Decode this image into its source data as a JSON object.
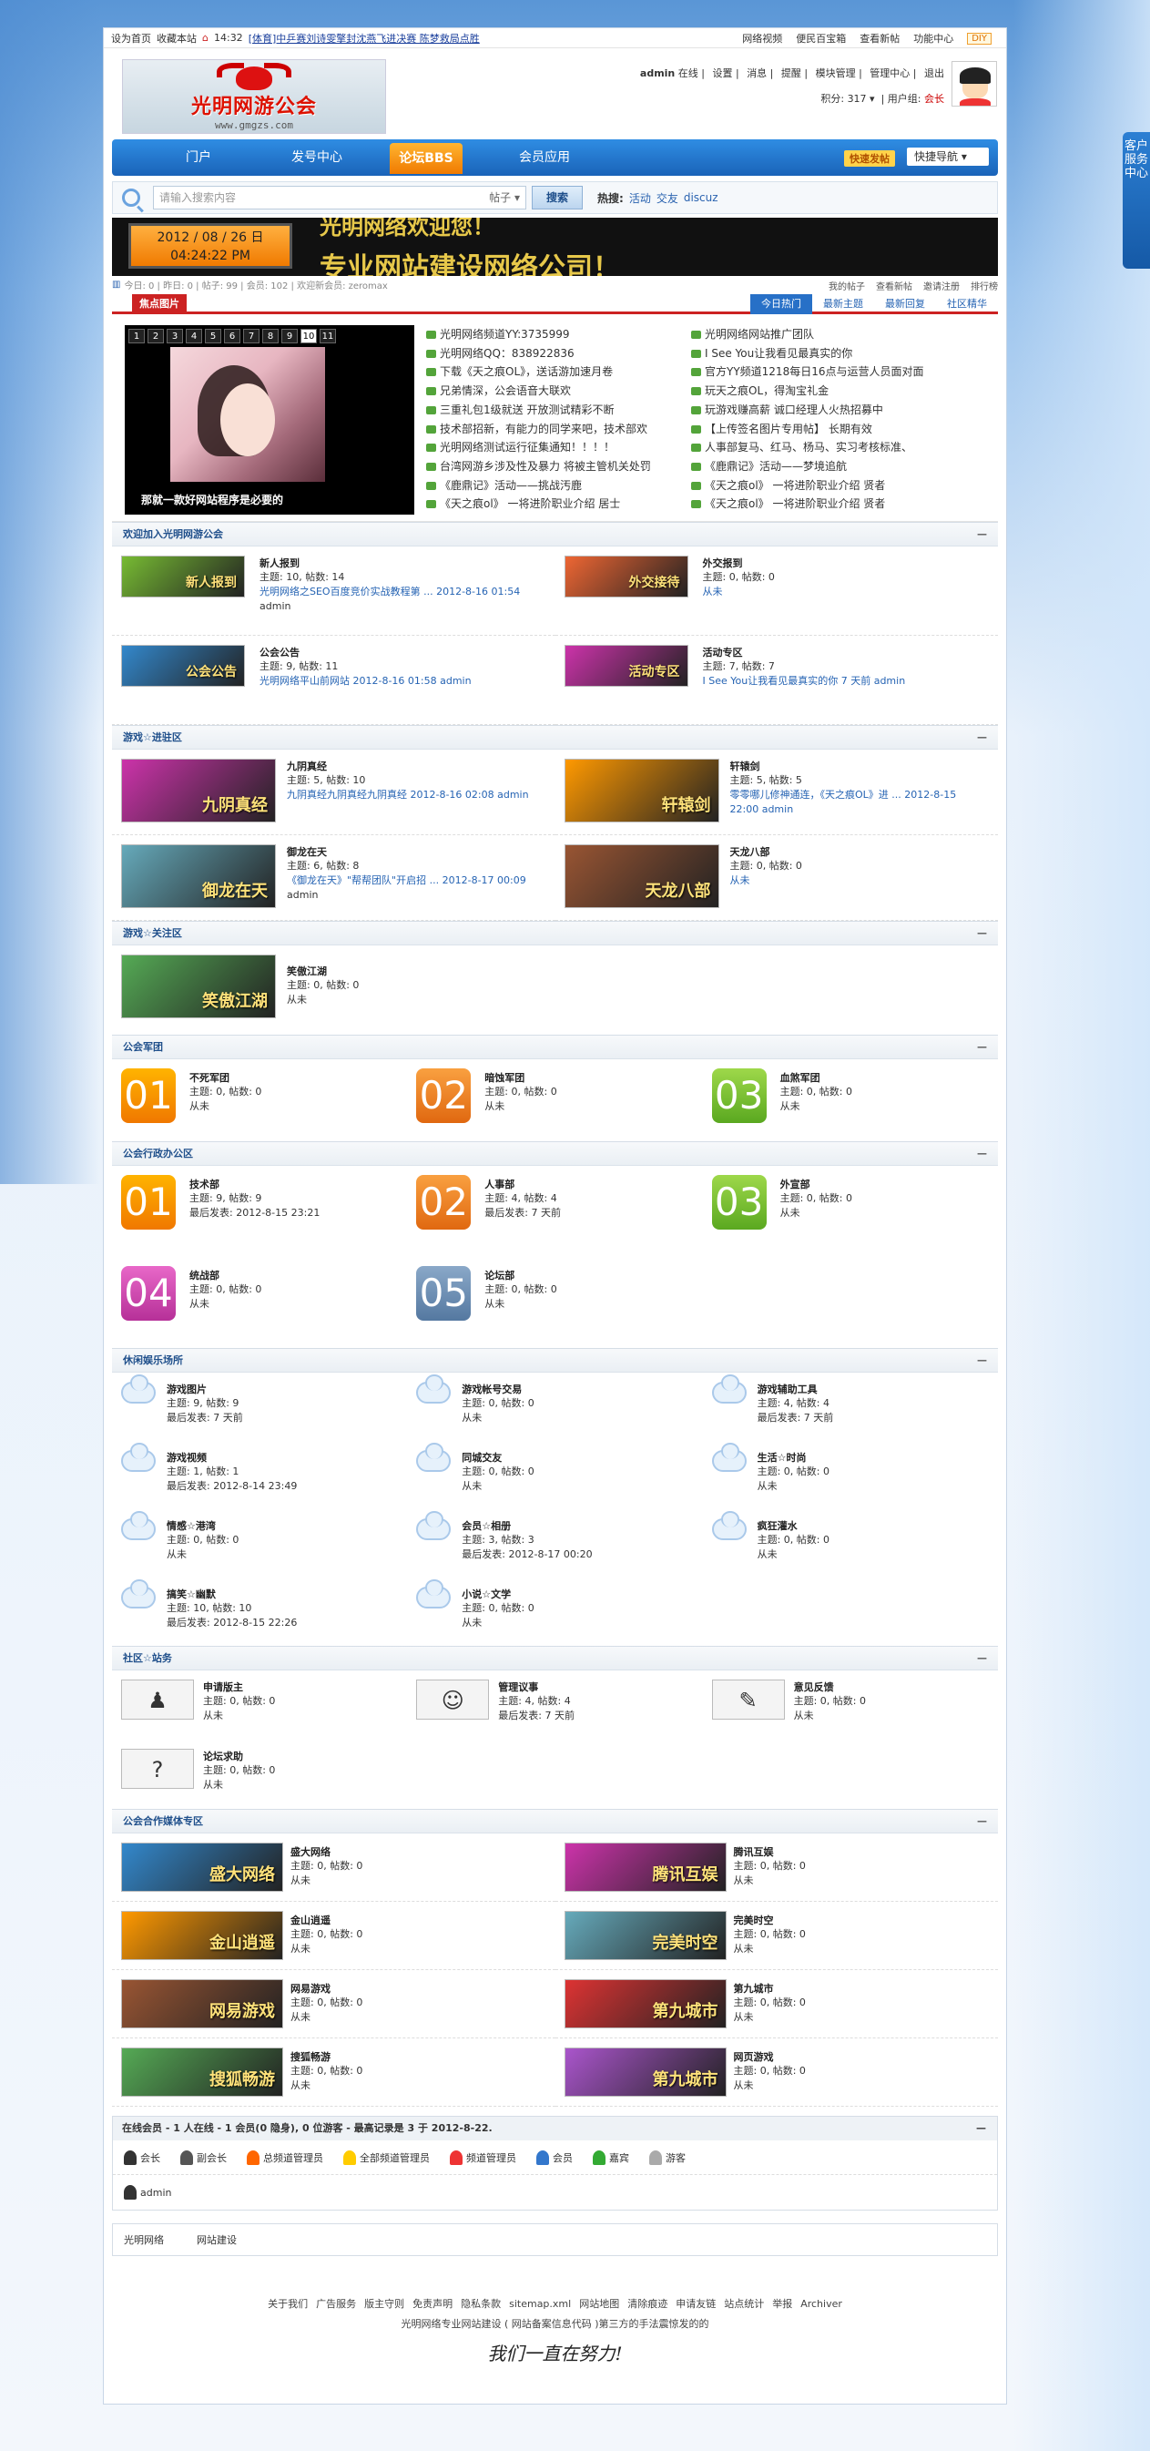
{
  "topbar": {
    "set_home": "设为首页",
    "bookmark": "收藏本站",
    "time": "14:32",
    "news": "[体育]中乒赛刘诗雯擎封沈燕飞进决赛 陈梦救局点胜",
    "right": [
      "网络视频",
      "便民百宝箱",
      "查看新帖",
      "功能中心"
    ],
    "diy": "DIY"
  },
  "logo": {
    "name": "光明网游公会",
    "url": "www.gmgzs.com"
  },
  "user": {
    "name": "admin",
    "status": "在线",
    "links": [
      "设置",
      "消息",
      "提醒",
      "模块管理",
      "管理中心",
      "退出"
    ],
    "points_label": "积分:",
    "points": "317",
    "group_label": "用户组:",
    "group": "会长"
  },
  "nav": {
    "items": [
      "门户",
      "发号中心",
      "论坛BBS",
      "会员应用"
    ],
    "post": "快速发帖",
    "quick": "快捷导航"
  },
  "search": {
    "placeholder": "请输入搜索内容",
    "type": "帖子",
    "button": "搜索",
    "hot_label": "热搜:",
    "hot": [
      "活动",
      "交友",
      "discuz"
    ]
  },
  "banner": {
    "date": "2012 / 08 / 26  日",
    "time": "04:24:22  PM",
    "line1": "光明网络欢迎您！",
    "line2": "专业网站建设网络公司！"
  },
  "stats": {
    "text": "今日: 0 | 昨日: 0 | 帖子: 99 | 会员: 102 | 欢迎新会员: zeromax",
    "links": [
      "我的帖子",
      "查看新帖",
      "邀请注册",
      "排行榜"
    ]
  },
  "tabs": {
    "left": "焦点图片",
    "right": [
      "今日热门",
      "最新主题",
      "最新回复",
      "社区精华"
    ]
  },
  "slider": {
    "nums": [
      "1",
      "2",
      "3",
      "4",
      "5",
      "6",
      "7",
      "8",
      "9",
      "10",
      "11"
    ],
    "current": "10",
    "caption": "那就一款好网站程序是必要的"
  },
  "focus": {
    "col1": [
      "光明网络频道YY:3735999",
      "光明网络QQ：838922836",
      "下载《天之痕OL》，送话游加速月卷",
      "兄弟情深，公会语音大联欢",
      "三重礼包1级就送 开放测试精彩不断",
      "技术部招新，有能力的同学来吧，技术部欢",
      "光明网络测试运行征集通知！！！！",
      "台湾网游乡涉及性及暴力 将被主管机关处罚",
      "《鹿鼎记》活动——挑战汚鹿",
      "《天之痕ol》 一将进阶职业介绍 居士"
    ],
    "col2": [
      "光明网络网站推广团队",
      "I See You让我看见最真实的你",
      "官方YY频道1218每日16点与运营人员面对面",
      "玩天之痕OL，得淘宝礼金",
      "玩游戏赚高薪 诚口经理人火热招募中",
      "【上传签名图片专用帖】 长期有效",
      "人事部复马、红马、杨马、实习考核标准、",
      "《鹿鼎记》活动——梦境追航",
      "《天之痕ol》 一将进阶职业介绍 贤者",
      "《天之痕ol》 一将进阶职业介绍 贤者"
    ]
  },
  "sec1": {
    "title": "欢迎加入光明网游公会",
    "forums": [
      {
        "name": "新人报到",
        "stat": "主题: 10, 帖数: 14",
        "last": "光明网络之SEO百度竞价实战教程第 ... 2012-8-16 01:54",
        "who": "admin",
        "img": "新人报到"
      },
      {
        "name": "外交报到",
        "stat": "主题: 0, 帖数: 0",
        "last": "从未",
        "who": "",
        "img": "外交接待"
      },
      {
        "name": "公会公告",
        "stat": "主题: 9, 帖数: 11",
        "last": "光明网络平山前网站 2012-8-16 01:58 admin",
        "who": "",
        "img": "公会公告"
      },
      {
        "name": "活动专区",
        "stat": "主题: 7, 帖数: 7",
        "last": "I See You让我看见最真实的你 7 天前 admin",
        "who": "",
        "img": "活动专区"
      }
    ]
  },
  "sec2": {
    "title": "游戏☆进驻区",
    "forums": [
      {
        "name": "九阴真经",
        "stat": "主题: 5, 帖数: 10",
        "last": "九阴真经九阴真经九阴真经 2012-8-16 02:08 admin",
        "img": "九阴真经"
      },
      {
        "name": "轩辕剑",
        "stat": "主题: 5, 帖数: 5",
        "last": "零零哪儿修神通连，《天之痕OL》进 ... 2012-8-15 22:00 admin",
        "img": "轩辕剑"
      },
      {
        "name": "御龙在天",
        "stat": "主题: 6, 帖数: 8",
        "last": "《御龙在天》\"帮帮团队\"开启招 ... 2012-8-17 00:09",
        "who": "admin",
        "img": "御龙在天"
      },
      {
        "name": "天龙八部",
        "stat": "主题: 0, 帖数: 0",
        "last": "从未",
        "img": "天龙八部"
      }
    ]
  },
  "sec3": {
    "title": "游戏☆关注区",
    "forums": [
      {
        "name": "笑傲江湖",
        "stat": "主题: 0, 帖数: 0",
        "last": "从未",
        "img": "笑傲江湖"
      }
    ]
  },
  "sec4": {
    "title": "公会军团",
    "forums": [
      {
        "num": "01",
        "name": "不死军团",
        "stat": "主题: 0, 帖数: 0",
        "last": "从未"
      },
      {
        "num": "02",
        "name": "暗蚀军团",
        "stat": "主题: 0, 帖数: 0",
        "last": "从未"
      },
      {
        "num": "03",
        "name": "血煞军团",
        "stat": "主题: 0, 帖数: 0",
        "last": "从未"
      }
    ]
  },
  "sec5": {
    "title": "公会行政办公区",
    "forums": [
      {
        "num": "01",
        "name": "技术部",
        "stat": "主题: 9, 帖数: 9",
        "last": "最后发表: 2012-8-15 23:21"
      },
      {
        "num": "02",
        "name": "人事部",
        "stat": "主题: 4, 帖数: 4",
        "last": "最后发表: 7 天前"
      },
      {
        "num": "03",
        "name": "外宣部",
        "stat": "主题: 0, 帖数: 0",
        "last": "从未"
      },
      {
        "num": "04",
        "name": "统战部",
        "stat": "主题: 0, 帖数: 0",
        "last": "从未"
      },
      {
        "num": "05",
        "name": "论坛部",
        "stat": "主题: 0, 帖数: 0",
        "last": "从未"
      }
    ]
  },
  "sec6": {
    "title": "休闲娱乐场所",
    "forums": [
      {
        "name": "游戏图片",
        "stat": "主题: 9, 帖数: 9",
        "last": "最后发表: 7 天前"
      },
      {
        "name": "游戏帐号交易",
        "stat": "主题: 0, 帖数: 0",
        "last": "从未"
      },
      {
        "name": "游戏辅助工具",
        "stat": "主题: 4, 帖数: 4",
        "last": "最后发表: 7 天前"
      },
      {
        "name": "游戏视频",
        "stat": "主题: 1, 帖数: 1",
        "last": "最后发表: 2012-8-14 23:49"
      },
      {
        "name": "同城交友",
        "stat": "主题: 0, 帖数: 0",
        "last": "从未"
      },
      {
        "name": "生活☆时尚",
        "stat": "主题: 0, 帖数: 0",
        "last": "从未"
      },
      {
        "name": "情感☆港湾",
        "stat": "主题: 0, 帖数: 0",
        "last": "从未"
      },
      {
        "name": "会员☆相册",
        "stat": "主题: 3, 帖数: 3",
        "last": "最后发表: 2012-8-17 00:20"
      },
      {
        "name": "疯狂灌水",
        "stat": "主题: 0, 帖数: 0",
        "last": "从未"
      },
      {
        "name": "搞笑☆幽默",
        "stat": "主题: 10, 帖数: 10",
        "last": "最后发表: 2012-8-15 22:26"
      },
      {
        "name": "小说☆文学",
        "stat": "主题: 0, 帖数: 0",
        "last": "从未"
      }
    ]
  },
  "sec7": {
    "title": "社区☆站务",
    "forums": [
      {
        "name": "申请版主",
        "stat": "主题: 0, 帖数: 0",
        "last": "从未"
      },
      {
        "name": "管理议事",
        "stat": "主题: 4, 帖数: 4",
        "last": "最后发表: 7 天前"
      },
      {
        "name": "意见反馈",
        "stat": "主题: 0, 帖数: 0",
        "last": "从未"
      },
      {
        "name": "论坛求助",
        "stat": "主题: 0, 帖数: 0",
        "last": "从未"
      }
    ]
  },
  "sec8": {
    "title": "公会合作媒体专区",
    "forums": [
      {
        "name": "盛大网络",
        "stat": "主题: 0, 帖数: 0",
        "last": "从未",
        "img": "盛大网络"
      },
      {
        "name": "腾讯互娱",
        "stat": "主题: 0, 帖数: 0",
        "last": "从未",
        "img": "腾讯互娱"
      },
      {
        "name": "金山逍遥",
        "stat": "主题: 0, 帖数: 0",
        "last": "从未",
        "img": "金山逍遥"
      },
      {
        "name": "完美时空",
        "stat": "主题: 0, 帖数: 0",
        "last": "从未",
        "img": "完美时空"
      },
      {
        "name": "网易游戏",
        "stat": "主题: 0, 帖数: 0",
        "last": "从未",
        "img": "网易游戏"
      },
      {
        "name": "第九城市",
        "stat": "主题: 0, 帖数: 0",
        "last": "从未",
        "img": "第九城市"
      },
      {
        "name": "搜狐畅游",
        "stat": "主题: 0, 帖数: 0",
        "last": "从未",
        "img": "搜狐畅游"
      },
      {
        "name": "网页游戏",
        "stat": "主题: 0, 帖数: 0",
        "last": "从未",
        "img": "第九城市"
      }
    ]
  },
  "online": {
    "title": "在线会员 - 1 人在线 - 1 会员(0 隐身), 0 位游客 - 最高记录是 3 于 2012-8-22.",
    "legend": [
      "会长",
      "副会长",
      "总频道管理员",
      "全部频道管理员",
      "频道管理员",
      "会员",
      "嘉宾",
      "游客"
    ],
    "users": [
      "admin"
    ]
  },
  "friends": [
    "光明网络",
    "网站建设"
  ],
  "footer": {
    "links": [
      "关于我们",
      "广告服务",
      "版主守则",
      "免责声明",
      "隐私条款",
      "sitemap.xml",
      "网站地图",
      "清除痕迹",
      "申请友链",
      "站点统计",
      "举报",
      "Archiver"
    ],
    "line2": "光明网络专业网站建设 ( 网站备案信息代码 )第三方的手法震惊发的的",
    "sig": "我们一直在努力!"
  },
  "qq": "客户服务中心"
}
